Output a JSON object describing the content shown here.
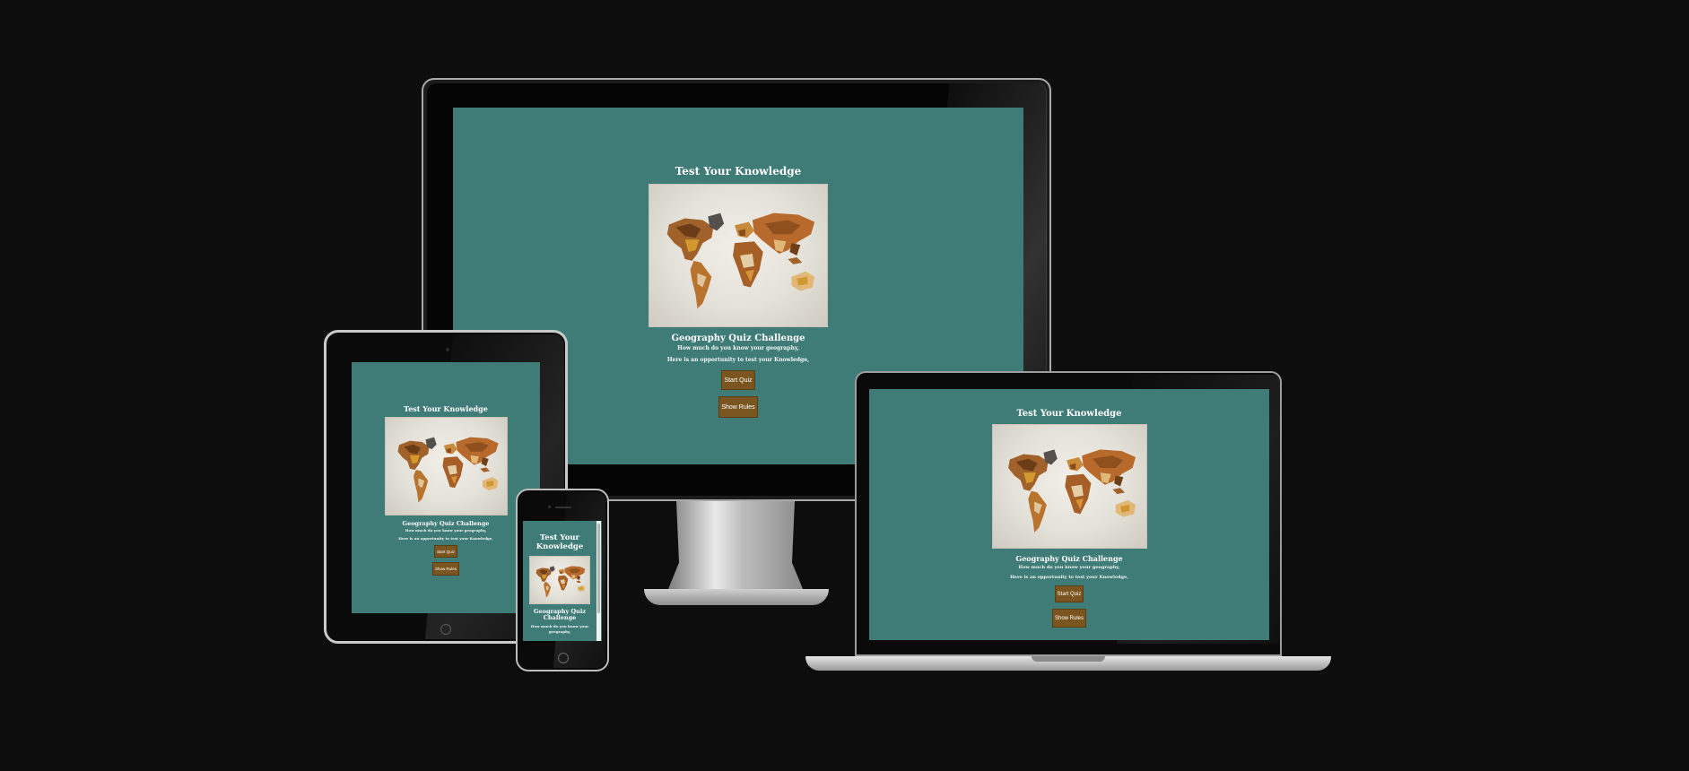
{
  "page": {
    "title": "Test Your Knowledge",
    "image_alt": "World map puzzle",
    "subtitle": "Geography Quiz Challenge",
    "line1": "How much do you know your geography,",
    "line2": "Here is an opportunity to test your Knowledge,",
    "start_button": "Start Quiz",
    "rules_button": "Show Rules"
  },
  "colors": {
    "background": "#0e0d0e",
    "screen_teal": "#3f7c78",
    "button_brown": "#7a5520",
    "text": "#ffffff"
  },
  "devices": [
    "desktop",
    "tablet",
    "phone",
    "laptop"
  ],
  "icons": [
    "world-map-image",
    "home-button-icon",
    "camera-icon"
  ]
}
